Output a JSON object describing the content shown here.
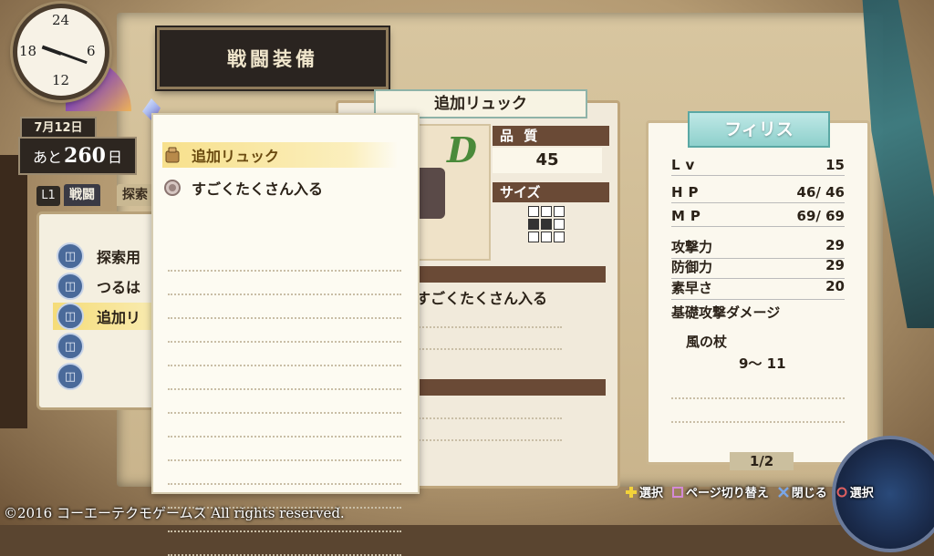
{
  "header": {
    "title": "戦闘装備",
    "date": "7月12日",
    "days_prefix": "あと",
    "days_value": "260",
    "days_suffix": "日",
    "clock_numbers": [
      "24",
      "6",
      "12",
      "18"
    ]
  },
  "tabs": {
    "shoulder": "L1",
    "items": [
      "戦闘",
      "探索"
    ]
  },
  "inventory": {
    "items": [
      "探索用",
      "つるは",
      "追加リ",
      "",
      ""
    ],
    "selected_index": 2
  },
  "item_card": {
    "name": "追加リュック",
    "quality_label": "品 質",
    "quality_value": "45",
    "size_label": "サイズ",
    "size_cells": [
      0,
      0,
      0,
      1,
      1,
      0,
      0,
      0,
      0
    ],
    "effect_text": "すごくたくさん入る",
    "image_letter": "D"
  },
  "popup": {
    "items": [
      "追加リュック",
      "すごくたくさん入る"
    ]
  },
  "character": {
    "name": "フィリス",
    "stats": [
      {
        "label": "Lv",
        "value": "15"
      },
      {
        "label": "HP",
        "value": "46/ 46"
      },
      {
        "label": "MP",
        "value": "69/ 69"
      },
      {
        "label": "攻撃力",
        "value": "29"
      },
      {
        "label": "防御力",
        "value": "29"
      },
      {
        "label": "素早さ",
        "value": "20"
      }
    ],
    "base_damage_label": "基礎攻撃ダメージ",
    "weapon_name": "風の杖",
    "weapon_damage": "9～ 11",
    "page": "1/2"
  },
  "hints": [
    {
      "label": "選択",
      "icon": "dpad-icon",
      "color": "#f2d23a"
    },
    {
      "label": "ページ切り替え",
      "icon": "square-button-icon",
      "color": "#d48ad6"
    },
    {
      "label": "閉じる",
      "icon": "cross-button-icon",
      "color": "#7aa6e6"
    },
    {
      "label": "選択",
      "icon": "circle-button-icon",
      "color": "#e06060"
    }
  ],
  "footer": {
    "copyright": "©2016 コーエーテクモゲームス All rights reserved."
  }
}
